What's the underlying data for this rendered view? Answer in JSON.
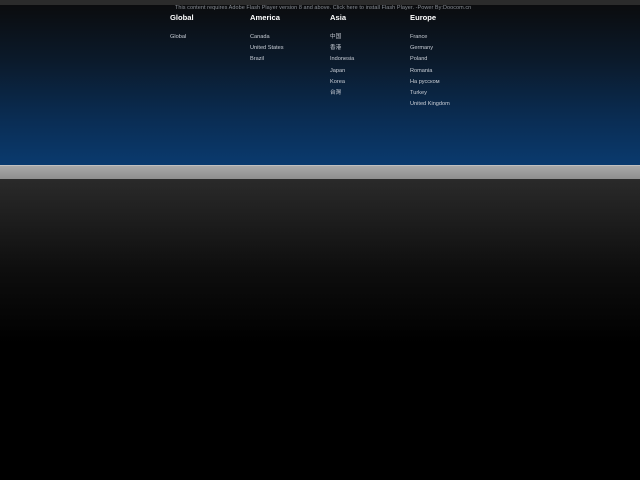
{
  "flash_notice": "This content requires Adobe Flash Player version 8 and above. Click here to install Flash Player. -Power By:Doocom.cn",
  "regions": [
    {
      "heading": "Global",
      "links": [
        "Global"
      ]
    },
    {
      "heading": "America",
      "links": [
        "Canada",
        "United States",
        "Brazil"
      ]
    },
    {
      "heading": "Asia",
      "links": [
        "中国",
        "香港",
        "Indonesia",
        "Japan",
        "Korea",
        "台灣"
      ]
    },
    {
      "heading": "Europe",
      "links": [
        "France",
        "Germany",
        "Poland",
        "Romania",
        "На русском",
        "Turkey",
        "United Kingdom"
      ]
    }
  ],
  "colors": {
    "hero_top": "#0b0c0e",
    "hero_bottom": "#0a3a6e",
    "divider": "#9a9a9a",
    "heading_text": "#ffffff",
    "link_text": "#c9ced6"
  }
}
